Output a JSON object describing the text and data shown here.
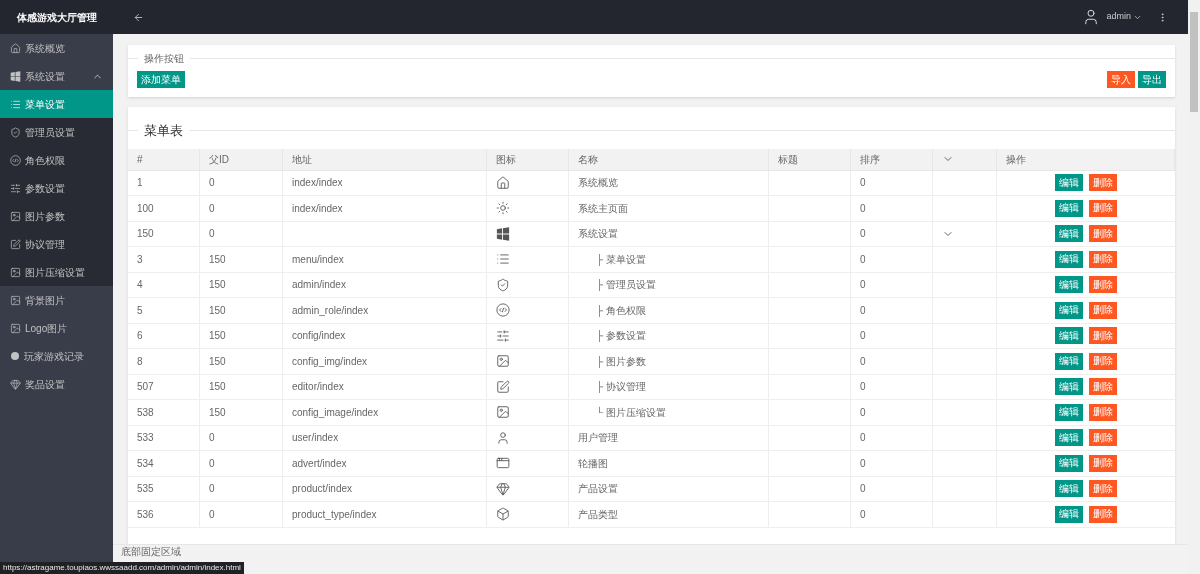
{
  "sidebar": {
    "title": "体感游戏大厅管理",
    "items": [
      {
        "label": "系统概览",
        "kind": "home",
        "selected": false
      },
      {
        "label": "系统设置",
        "kind": "windows",
        "selected": false,
        "expanded": true,
        "children": [
          {
            "label": "菜单设置",
            "kind": "list",
            "selected": true
          },
          {
            "label": "管理员设置",
            "kind": "shield",
            "selected": false
          },
          {
            "label": "角色权限",
            "kind": "code",
            "selected": false
          },
          {
            "label": "参数设置",
            "kind": "sliders",
            "selected": false
          },
          {
            "label": "图片参数",
            "kind": "image",
            "selected": false
          },
          {
            "label": "协议管理",
            "kind": "edit",
            "selected": false
          },
          {
            "label": "图片压缩设置",
            "kind": "image",
            "selected": false
          }
        ]
      },
      {
        "label": "背景图片",
        "kind": "image",
        "selected": false
      },
      {
        "label": "Logo图片",
        "kind": "image",
        "selected": false
      },
      {
        "label": "玩家游戏记录",
        "kind": "dot",
        "selected": false
      },
      {
        "label": "奖品设置",
        "kind": "diamond",
        "selected": false
      }
    ]
  },
  "header": {
    "user": "admin"
  },
  "actions_card": {
    "legend": "操作按钮",
    "add_button": "添加菜单",
    "import_button": "导入",
    "export_button": "导出"
  },
  "table": {
    "title": "菜单表",
    "columns": [
      "#",
      "父ID",
      "地址",
      "图标",
      "名称",
      "标题",
      "排序",
      "操作"
    ],
    "rows": [
      {
        "id": "1",
        "parent": "0",
        "path": "index/index",
        "kind": "home",
        "name": "系统概览",
        "sort": "0",
        "expanded": false,
        "edit_button": "编辑",
        "delete_button": "删除"
      },
      {
        "id": "100",
        "parent": "0",
        "path": "index/index",
        "kind": "sun",
        "name": "系统主页面",
        "sort": "0",
        "expanded": false,
        "edit_button": "编辑",
        "delete_button": "删除"
      },
      {
        "id": "150",
        "parent": "0",
        "path": "",
        "kind": "windows",
        "name": "系统设置",
        "sort": "0",
        "expanded": true,
        "edit_button": "编辑",
        "delete_button": "删除"
      },
      {
        "id": "3",
        "parent": "150",
        "path": "menu/index",
        "kind": "list",
        "name": "├ 菜单设置",
        "sort": "0",
        "expanded": false,
        "edit_button": "编辑",
        "delete_button": "删除"
      },
      {
        "id": "4",
        "parent": "150",
        "path": "admin/index",
        "kind": "shield",
        "name": "├ 管理员设置",
        "sort": "0",
        "expanded": false,
        "edit_button": "编辑",
        "delete_button": "删除"
      },
      {
        "id": "5",
        "parent": "150",
        "path": "admin_role/index",
        "kind": "code",
        "name": "├ 角色权限",
        "sort": "0",
        "expanded": false,
        "edit_button": "编辑",
        "delete_button": "删除"
      },
      {
        "id": "6",
        "parent": "150",
        "path": "config/index",
        "kind": "sliders",
        "name": "├ 参数设置",
        "sort": "0",
        "expanded": false,
        "edit_button": "编辑",
        "delete_button": "删除"
      },
      {
        "id": "8",
        "parent": "150",
        "path": "config_img/index",
        "kind": "image",
        "name": "├ 图片参数",
        "sort": "0",
        "expanded": false,
        "edit_button": "编辑",
        "delete_button": "删除"
      },
      {
        "id": "507",
        "parent": "150",
        "path": "editor/index",
        "kind": "edit",
        "name": "├ 协议管理",
        "sort": "0",
        "expanded": false,
        "edit_button": "编辑",
        "delete_button": "删除"
      },
      {
        "id": "538",
        "parent": "150",
        "path": "config_image/index",
        "kind": "image",
        "name": "└ 图片压缩设置",
        "sort": "0",
        "expanded": false,
        "edit_button": "编辑",
        "delete_button": "删除"
      },
      {
        "id": "533",
        "parent": "0",
        "path": "user/index",
        "kind": "user",
        "name": "用户管理",
        "sort": "0",
        "expanded": false,
        "edit_button": "编辑",
        "delete_button": "删除"
      },
      {
        "id": "534",
        "parent": "0",
        "path": "advert/index",
        "kind": "browser",
        "name": "轮播图",
        "sort": "0",
        "expanded": false,
        "edit_button": "编辑",
        "delete_button": "删除"
      },
      {
        "id": "535",
        "parent": "0",
        "path": "product/index",
        "kind": "diamond",
        "name": "产品设置",
        "sort": "0",
        "expanded": false,
        "edit_button": "编辑",
        "delete_button": "删除"
      },
      {
        "id": "536",
        "parent": "0",
        "path": "product_type/index",
        "kind": "box",
        "name": "产品类型",
        "sort": "0",
        "expanded": false,
        "edit_button": "编辑",
        "delete_button": "删除"
      }
    ]
  },
  "footer": {
    "text": "底部固定区域"
  },
  "status_url": "https://astragame.toupiaos.wwssaadd.com/admin/admin/index.html"
}
